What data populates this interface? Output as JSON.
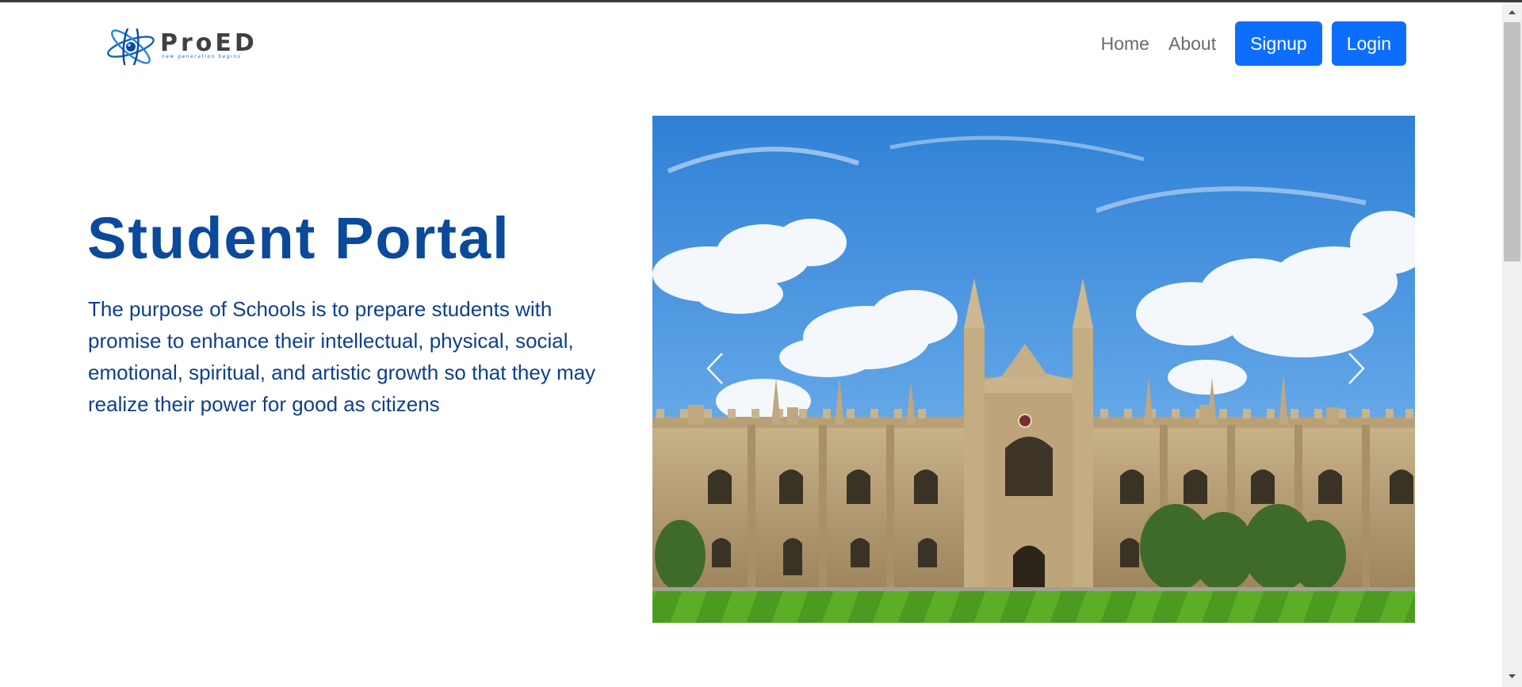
{
  "brand": {
    "name": "ProED",
    "tagline": "new generation begins"
  },
  "nav": {
    "home_label": "Home",
    "about_label": "About",
    "signup_label": "Signup",
    "login_label": "Login"
  },
  "hero": {
    "title": "Student Portal",
    "description": "The purpose of Schools is to prepare students with promise to enhance their intellectual, physical, social, emotional, spiritual, and artistic growth so that they may realize their power for good as citizens"
  },
  "carousel": {
    "prev_icon": "chevron-left-icon",
    "next_icon": "chevron-right-icon"
  },
  "colors": {
    "accent": "#0d6efd",
    "title": "#0b4a9a",
    "body_text": "#0e3f8f",
    "nav_text": "#6b6b6b"
  }
}
